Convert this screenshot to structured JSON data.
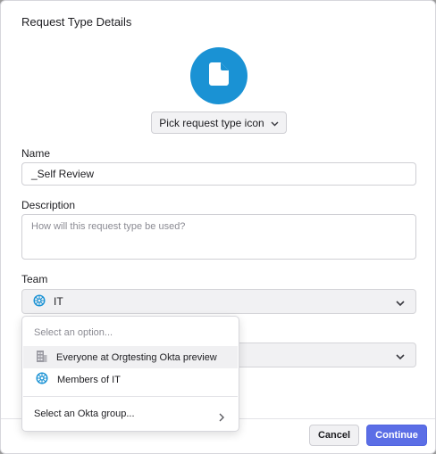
{
  "dialog": {
    "title": "Request Type Details",
    "icon_name": "document-icon",
    "icon_bg": "#1a92d4",
    "picker_label": "Pick request type icon"
  },
  "form": {
    "name_label": "Name",
    "name_value": "_Self Review",
    "description_label": "Description",
    "description_placeholder": "How will this request type be used?",
    "team_label": "Team",
    "team_value": "IT",
    "team_icon": "team-wheel-icon"
  },
  "dropdown": {
    "placeholder": "Select an option...",
    "options": [
      {
        "label": "Everyone at Orgtesting Okta preview",
        "icon": "building-icon"
      },
      {
        "label": "Members of IT",
        "icon": "team-wheel-icon"
      }
    ],
    "group_link": "Select an Okta group..."
  },
  "footer": {
    "cancel_label": "Cancel",
    "continue_label": "Continue"
  },
  "colors": {
    "accent": "#5b6ee6",
    "team_icon_color": "#1a92d4"
  }
}
